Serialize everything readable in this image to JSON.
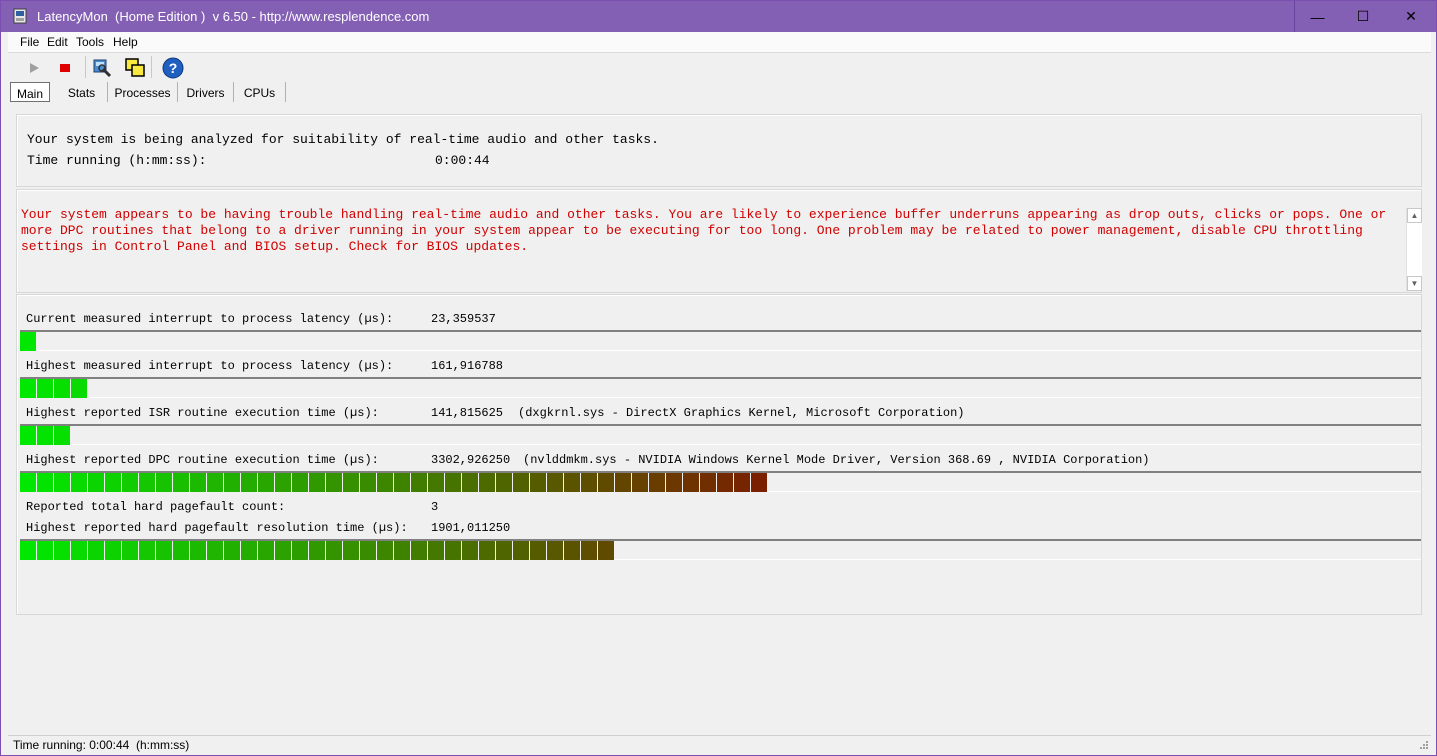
{
  "window": {
    "title": "LatencyMon  (Home Edition )  v 6.50 - http://www.resplendence.com",
    "min_glyph": "—",
    "max_glyph": "☐",
    "close_glyph": "✕"
  },
  "menu": [
    "File",
    "Edit",
    "Tools",
    "Help"
  ],
  "toolbar": {
    "icons": [
      "play-icon",
      "stop-icon",
      "search-driver-icon",
      "copy-windows-icon",
      "help-icon"
    ]
  },
  "tabs": [
    "Main",
    "Stats",
    "Processes",
    "Drivers",
    "CPUs"
  ],
  "analysis": {
    "line1": "Your system is being analyzed for suitability of real-time audio and other tasks.",
    "time_label": "Time running (h:mm:ss):",
    "time_value": "0:00:44"
  },
  "verdict": {
    "message": "Your system appears to be having trouble handling real-time audio and other tasks. You are likely to experience buffer underruns appearing as drop outs, clicks or pops. One or more DPC routines that belong to a driver running in your system appear to be executing for too long. One problem may be related to power management, disable CPU throttling settings in Control Panel and BIOS setup. Check for BIOS updates.",
    "color": "#d00000"
  },
  "metrics": [
    {
      "label": "Current measured interrupt to process latency (µs):",
      "value": "23,359537",
      "extra": "",
      "segments": 1
    },
    {
      "label": "Highest measured interrupt to process latency (µs):",
      "value": "161,916788",
      "extra": "",
      "segments": 4
    },
    {
      "label": "Highest reported ISR routine execution time (µs):",
      "value": "141,815625",
      "extra": "(dxgkrnl.sys - DirectX Graphics Kernel, Microsoft Corporation)",
      "segments": 3
    },
    {
      "label": "Highest reported DPC routine execution time (µs):",
      "value": "3302,926250",
      "extra": "(nvlddmkm.sys - NVIDIA Windows Kernel Mode Driver, Version 368.69 , NVIDIA Corporation)",
      "segments": 44
    }
  ],
  "pagefault": {
    "count_label": "Reported total hard pagefault count:",
    "count_value": "3",
    "time_label": "Highest reported hard pagefault resolution time (µs):",
    "time_value": "1901,011250",
    "segments": 35
  },
  "bar_colors": {
    "start": "#00e800",
    "end": "#7a2000"
  },
  "status": {
    "text": "Time running: 0:00:44  (h:mm:ss)"
  }
}
